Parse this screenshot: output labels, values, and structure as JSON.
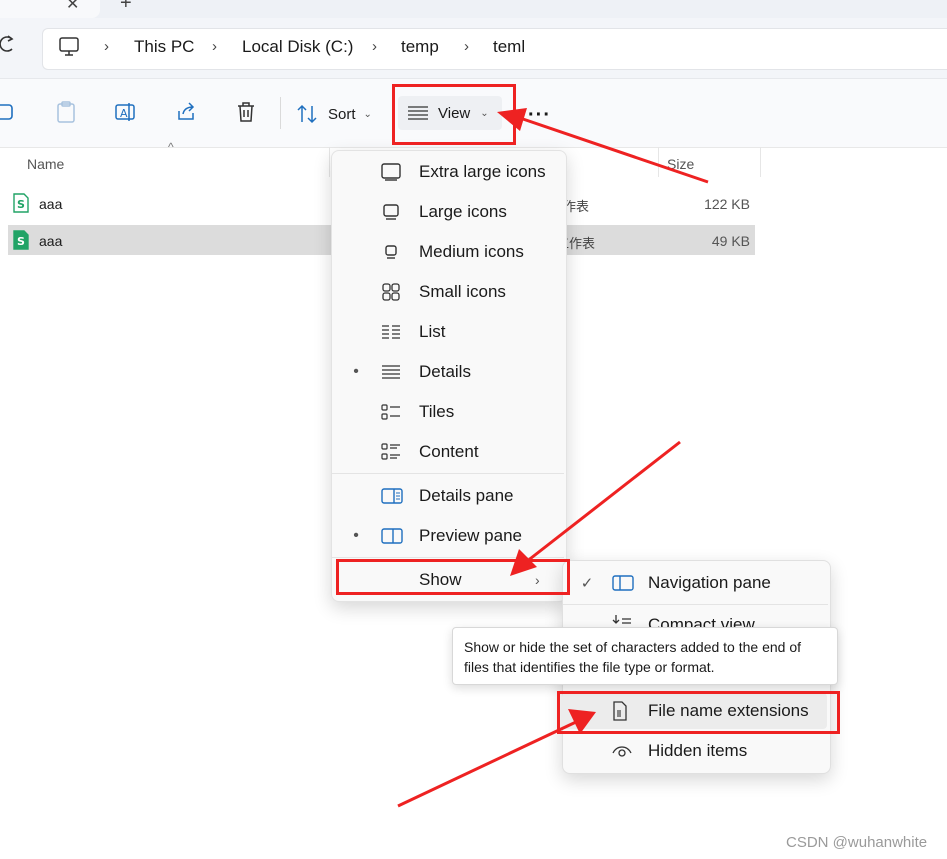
{
  "address": {
    "crumbs": [
      "This PC",
      "Local Disk (C:)",
      "temp",
      "teml"
    ]
  },
  "toolbar": {
    "sort_label": "Sort",
    "view_label": "View",
    "more_label": "···"
  },
  "file_list": {
    "columns": {
      "name": "Name",
      "size": "Size"
    },
    "rows": [
      {
        "name": "aaa",
        "type": "作表",
        "size": "122 KB",
        "selected": false
      },
      {
        "name": "aaa",
        "type": "工作表",
        "size": "49 KB",
        "selected": true
      }
    ]
  },
  "view_menu": {
    "items": [
      {
        "label": "Extra large icons",
        "icon": "extra-large-icons-icon",
        "selected": false
      },
      {
        "label": "Large icons",
        "icon": "large-icons-icon",
        "selected": false
      },
      {
        "label": "Medium icons",
        "icon": "medium-icons-icon",
        "selected": false
      },
      {
        "label": "Small icons",
        "icon": "small-icons-icon",
        "selected": false
      },
      {
        "label": "List",
        "icon": "list-icon",
        "selected": false
      },
      {
        "label": "Details",
        "icon": "details-icon",
        "selected": true
      },
      {
        "label": "Tiles",
        "icon": "tiles-icon",
        "selected": false
      },
      {
        "label": "Content",
        "icon": "content-icon",
        "selected": false
      }
    ],
    "panes": [
      {
        "label": "Details pane",
        "icon": "details-pane-icon",
        "selected": false
      },
      {
        "label": "Preview pane",
        "icon": "preview-pane-icon",
        "selected": true
      }
    ],
    "show_label": "Show"
  },
  "show_submenu": {
    "items": [
      {
        "label": "Navigation pane",
        "icon": "navigation-pane-icon",
        "checked": true
      },
      {
        "label": "Compact view",
        "icon": "compact-view-icon",
        "checked": false
      },
      {
        "label": "File name extensions",
        "icon": "file-extension-icon",
        "checked": false,
        "highlighted": true
      },
      {
        "label": "Hidden items",
        "icon": "hidden-items-icon",
        "checked": false
      }
    ]
  },
  "tooltip": {
    "text": "Show or hide the set of characters added to the end of files that identifies the file type or format."
  },
  "watermark": "CSDN @wuhanwhite",
  "colors": {
    "annotation": "#ee2222",
    "selected_row": "#dcdcdc",
    "excel_green": "#21a366"
  }
}
